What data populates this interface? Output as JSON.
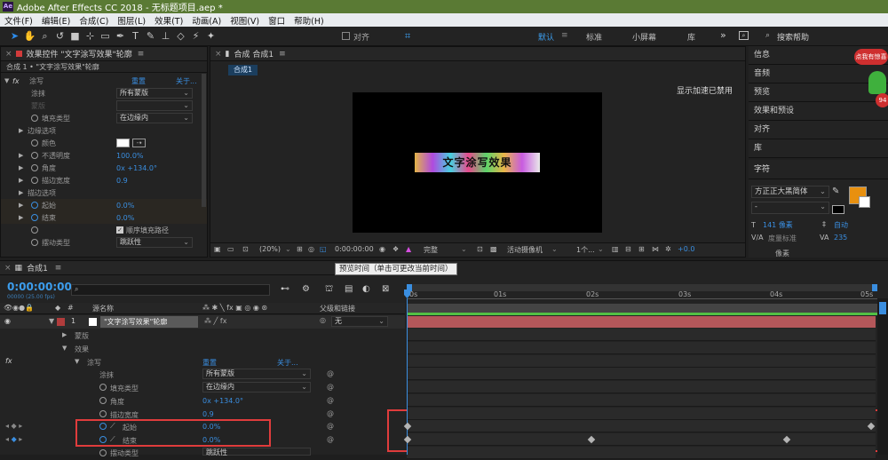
{
  "titlebar": {
    "logo": "Ae",
    "title": "Adobe After Effects CC 2018 - 无标题项目.aep *"
  },
  "menu": [
    "文件(F)",
    "编辑(E)",
    "合成(C)",
    "图层(L)",
    "效果(T)",
    "动画(A)",
    "视图(V)",
    "窗口",
    "帮助(H)"
  ],
  "toolbar": {
    "snap_label": "对齐",
    "workspaces": [
      "默认",
      "标准",
      "小屏幕",
      "库"
    ],
    "active_workspace": "默认",
    "search_placeholder": "搜索帮助",
    "expand": "»",
    "menu": "≡"
  },
  "effects_panel": {
    "tab_title": "效果控件 \"文字涂写效果\"轮廓",
    "breadcrumb": "合成 1 • \"文字涂写效果\"轮廓",
    "effect_name": "涂写",
    "reset": "重置",
    "about": "关于...",
    "fx": "fx",
    "rows": [
      {
        "name": "涂抹",
        "value": "所有蒙版"
      },
      {
        "name": "蒙版",
        "value": ""
      },
      {
        "name": "填充类型",
        "value": "在边缘内"
      },
      {
        "name": "边缘选项",
        "value": ""
      },
      {
        "name": "颜色",
        "value": ""
      },
      {
        "name": "不透明度",
        "value": "100.0%"
      },
      {
        "name": "角度",
        "value": "0x +134.0°"
      },
      {
        "name": "描边宽度",
        "value": "0.9"
      },
      {
        "name": "描边选项",
        "value": ""
      },
      {
        "name": "起始",
        "value": "0.0%"
      },
      {
        "name": "结束",
        "value": "0.0%"
      },
      {
        "name": "",
        "value": "顺序填充路径"
      },
      {
        "name": "摆动类型",
        "value": "跳跃性"
      }
    ]
  },
  "comp_panel": {
    "tab_title": "合成 合成1",
    "active_tab": "合成1",
    "gpu_text": "显示加速已禁用",
    "footage_text": "文字涂写效果",
    "zoom": "(20%)",
    "timecode": "0:00:00:00",
    "quality": "完整",
    "camera": "活动摄像机",
    "views": "1个...",
    "exposure": "+0.0",
    "tooltip": "预览时间（单击可更改当前时间）"
  },
  "right_panels": {
    "items": [
      "信息",
      "音频",
      "预览",
      "效果和预设",
      "对齐",
      "库"
    ],
    "badge_text": "点我有惊喜",
    "badge_number": "94",
    "char_title": "字符",
    "font": "方正正大黑简体",
    "style": "-",
    "size": "141 像素",
    "leading": "自动",
    "kerning": "度量标准",
    "tracking": "235",
    "bottom_label": "像素"
  },
  "timeline": {
    "tab_title": "合成1",
    "timecode": "0:00:00:00",
    "timecode_sub": "00000 (25.00 fps)",
    "search_placeholder": "",
    "col_source": "源名称",
    "col_parent": "父级和链接",
    "layer_num": "1",
    "layer_name": "\"文字涂写效果\"轮廓",
    "parent_value": "无",
    "ticks": [
      "0s",
      "01s",
      "02s",
      "03s",
      "04s",
      "05s"
    ],
    "rows": [
      {
        "name": "蒙版",
        "value": ""
      },
      {
        "name": "效果",
        "value": ""
      },
      {
        "name": "涂写",
        "value": "重置"
      },
      {
        "name": "涂抹",
        "value": "所有蒙版"
      },
      {
        "name": "填充类型",
        "value": "在边缘内"
      },
      {
        "name": "角度",
        "value": "0x +134.0°"
      },
      {
        "name": "描边宽度",
        "value": "0.9"
      },
      {
        "name": "起始",
        "value": "0.0%"
      },
      {
        "name": "结束",
        "value": "0.0%"
      },
      {
        "name": "摆动类型",
        "value": "跳跃性"
      }
    ],
    "about": "关于..."
  },
  "colors": {
    "accent": "#2d8ceb",
    "layer_bar": "#b4575a",
    "highlight_box": "#e03c3c",
    "work_area": "#52c044"
  }
}
